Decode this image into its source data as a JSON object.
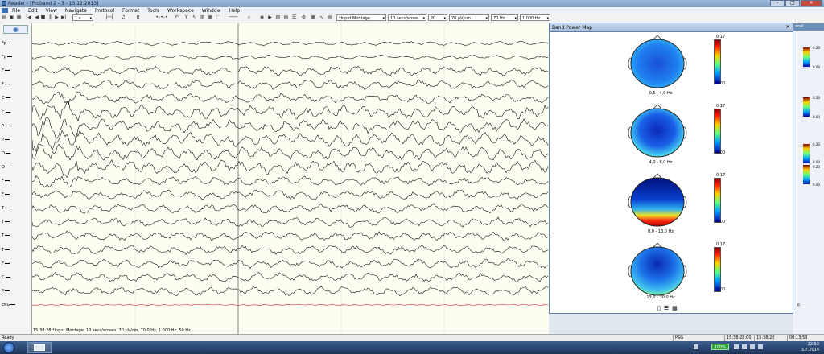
{
  "window": {
    "title": "Reader - [Proband 2 - 3 - 13.12.2013]"
  },
  "menu": [
    "File",
    "Edit",
    "View",
    "Navigate",
    "Protocol",
    "Format",
    "Tools",
    "Workspace",
    "Window",
    "Help"
  ],
  "toolbar": {
    "speed": "1 x",
    "montage": "*Input Montage",
    "timebase": "10 secs/scree",
    "channels": "20",
    "sensitivity": "70 µV/cm",
    "highcut": "70 Hz",
    "samplerate": "1.000 Hz"
  },
  "channels": [
    "Fp",
    "Fp",
    "F",
    "F",
    "C",
    "C",
    "P",
    "P",
    "O",
    "O",
    "F",
    "F",
    "T",
    "T",
    "T",
    "T",
    "F",
    "C",
    "P",
    "EKG"
  ],
  "montage_line": "15:38:28 *Input Montage, 10 secs/screen, 70 µV/cm, 70,0 Hz, 1.000 Hz, 50 Hz",
  "band_power_map": {
    "title": "Band Power Map",
    "scale_max": "0.17",
    "scale_min": "0.00",
    "bands": [
      "0,5 - 4,0 Hz",
      "4,0 - 8,0 Hz",
      "8,0 - 13,0 Hz",
      "13,0 - 30,0 Hz"
    ]
  },
  "right_panel": {
    "header": "anel",
    "scale_max": "0.23",
    "scale_min": "0.00"
  },
  "statusbar": {
    "left": "Ready",
    "mode": "PSG",
    "t1": "15:38:28:00",
    "t2": "15:38:28",
    "t3": "00:13:53"
  },
  "taskbar": {
    "battery": "100%",
    "time": "22:53",
    "date": "3.7.2014"
  },
  "colors": {
    "eeg_trace": "#000000",
    "ekg_trace": "#cc2020",
    "title_bg": "#9db9d8",
    "close": "#c8483a"
  }
}
